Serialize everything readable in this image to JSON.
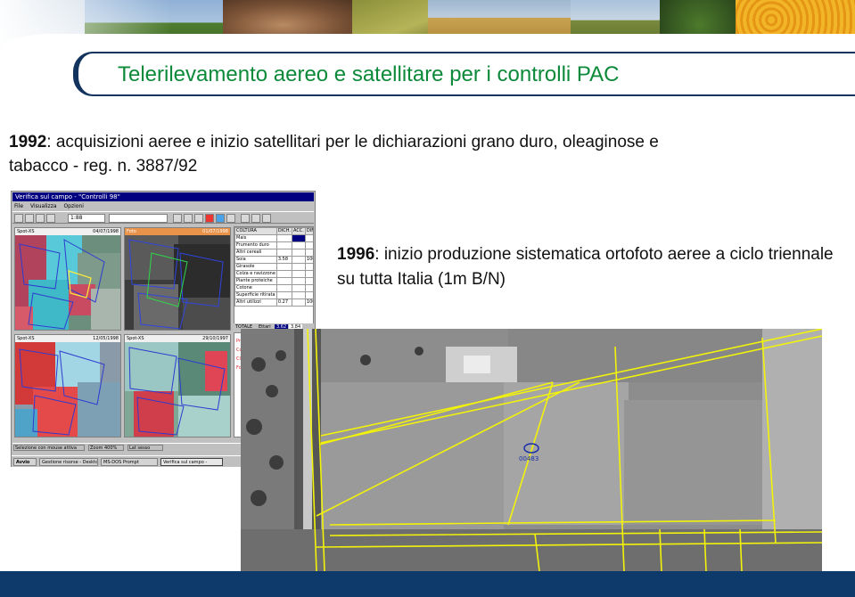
{
  "slide": {
    "title": "Telerilevamento aereo e satellitare per i controlli PAC",
    "para1_year": "1992",
    "para1_text": ": acquisizioni aeree e inizio satellitari per le dichiarazioni grano duro, oleaginose e tabacco - reg. n. 3887/92",
    "para2_year": "1996",
    "para2_text": ": inizio produzione sistematica ortofoto aeree a ciclo triennale su tutta Italia (1m B/N)"
  },
  "app": {
    "window_title": "Verifica sul campo - \"Controlli 98\"",
    "menu": [
      "File",
      "Visualizza",
      "Opzioni"
    ],
    "toolbar_combo": "1:88",
    "panes": [
      {
        "label": "Spot-XS",
        "date": "04/07/1998"
      },
      {
        "label": "Foto",
        "date": "01/07/1998"
      },
      {
        "label": "Spot-XS",
        "date": "12/05/1998"
      },
      {
        "label": "Spot-XS",
        "date": "29/10/1997"
      }
    ],
    "parcel_label": "00483",
    "table": {
      "headers": [
        "COLTURA",
        "DICH.",
        "ACC.",
        "DIFF."
      ],
      "rows": [
        [
          "Mais",
          "",
          "",
          ""
        ],
        [
          "Frumento duro",
          "",
          "",
          ""
        ],
        [
          "Altri cereali",
          "",
          "",
          ""
        ],
        [
          "Soia",
          "3.58",
          "",
          "100"
        ],
        [
          "Girasole",
          "",
          "",
          ""
        ],
        [
          "Colza e ravizzone",
          "",
          "",
          ""
        ],
        [
          "Piante proteiche",
          "",
          "",
          ""
        ],
        [
          "Cotone",
          "",
          "",
          ""
        ],
        [
          "Superficie ritirata",
          "",
          "",
          ""
        ],
        [
          "Altri utilizzi",
          "0.27",
          "",
          "100"
        ]
      ],
      "totals_label": "TOTALE",
      "totals_sub": "Ettari",
      "totals_v1": "3.62",
      "totals_v2": "3.84"
    },
    "status": [
      "Selezione con mouse attiva",
      "Zoom 400%",
      "Lat sesso"
    ],
    "taskbar": [
      "Avvio",
      "Gestione risorse - Desktop",
      "MS-DOS Prompt",
      "Verifica sul campo -"
    ]
  },
  "ortho": {
    "parcel_label": "00483"
  },
  "colors": {
    "title": "#0c8a3a",
    "frame": "#12335e",
    "footer": "#0d3a6b",
    "overlay_lines": "#f2f20a"
  }
}
